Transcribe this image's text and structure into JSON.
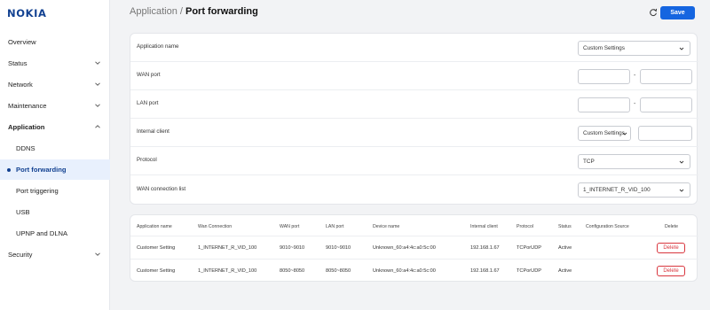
{
  "brand": {
    "logo_text": "NOKIA",
    "color": "#124191"
  },
  "sidebar": {
    "items": [
      {
        "label": "Overview",
        "expandable": false
      },
      {
        "label": "Status",
        "expandable": true,
        "expanded": false
      },
      {
        "label": "Network",
        "expandable": true,
        "expanded": false
      },
      {
        "label": "Maintenance",
        "expandable": true,
        "expanded": false
      },
      {
        "label": "Application",
        "expandable": true,
        "expanded": true
      },
      {
        "label": "DDNS",
        "sub": true
      },
      {
        "label": "Port forwarding",
        "sub": true,
        "active": true
      },
      {
        "label": "Port triggering",
        "sub": true
      },
      {
        "label": "USB",
        "sub": true
      },
      {
        "label": "UPNP and DLNA",
        "sub": true
      },
      {
        "label": "Security",
        "expandable": true,
        "expanded": false
      }
    ]
  },
  "header": {
    "breadcrumb_parent": "Application / ",
    "breadcrumb_current": "Port forwarding",
    "refresh_icon": "refresh-icon",
    "save_label": "Save",
    "accent_color": "#1565e0"
  },
  "form": {
    "application_name": {
      "label": "Application name",
      "value": "Custom Settings"
    },
    "wan_port": {
      "label": "WAN port",
      "start": "",
      "end": "",
      "separator": "-"
    },
    "lan_port": {
      "label": "LAN port",
      "start": "",
      "end": "",
      "separator": "-"
    },
    "internal_client": {
      "label": "Internal client",
      "mode": "Custom Settings",
      "value": ""
    },
    "protocol": {
      "label": "Protocol",
      "value": "TCP"
    },
    "wan_connection_list": {
      "label": "WAN connection list",
      "value": "1_INTERNET_R_VID_100"
    }
  },
  "table": {
    "headers": [
      "Application name",
      "Wan Connection",
      "WAN port",
      "LAN port",
      "Device name",
      "Internal client",
      "Protocol",
      "Status",
      "Configuration Source",
      "Delete"
    ],
    "rows": [
      [
        "Customer Setting",
        "1_INTERNET_R_VID_100",
        "9010~9010",
        "9010~9010",
        "Unknown_60:a4:4c:a0:5c:00",
        "192.168.1.67",
        "TCPorUDP",
        "Active",
        "",
        "Delete"
      ],
      [
        "Customer Setting",
        "1_INTERNET_R_VID_100",
        "8050~8050",
        "8050~8050",
        "Unknown_60:a4:4c:a0:5c:00",
        "192.168.1.67",
        "TCPorUDP",
        "Active",
        "",
        "Delete"
      ]
    ],
    "delete_color": "#d9363e"
  }
}
